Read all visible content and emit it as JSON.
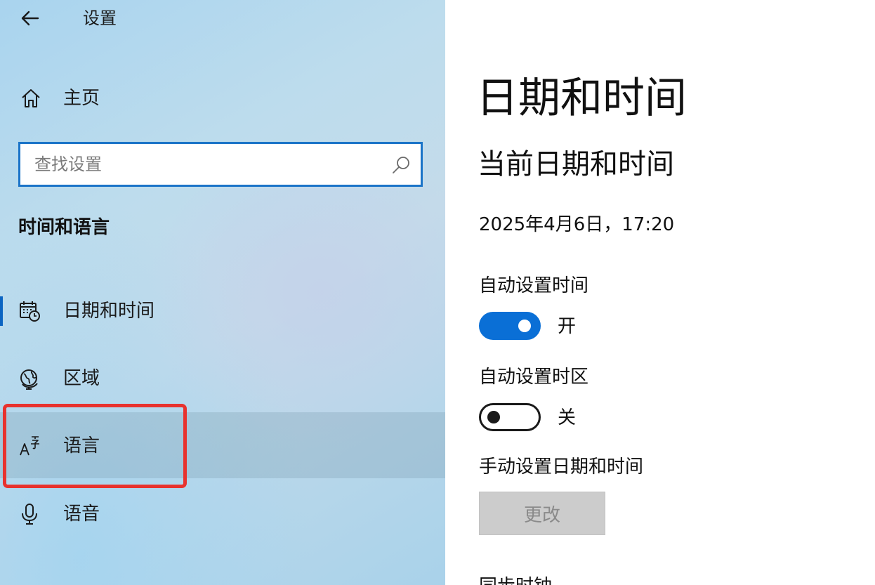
{
  "app": {
    "title": "设置"
  },
  "sidebar": {
    "home_label": "主页",
    "search": {
      "placeholder": "查找设置",
      "value": ""
    },
    "section_heading": "时间和语言",
    "items": [
      {
        "label": "日期和时间",
        "icon": "calendar-clock-icon",
        "active": true
      },
      {
        "label": "区域",
        "icon": "globe-icon",
        "active": false
      },
      {
        "label": "语言",
        "icon": "language-icon",
        "active": false,
        "highlighted": true
      },
      {
        "label": "语音",
        "icon": "microphone-icon",
        "active": false
      }
    ]
  },
  "main": {
    "page_title": "日期和时间",
    "current_section_title": "当前日期和时间",
    "current_datetime": "2025年4月6日，17:20",
    "auto_time": {
      "label": "自动设置时间",
      "on": true,
      "state_label": "开"
    },
    "auto_timezone": {
      "label": "自动设置时区",
      "on": false,
      "state_label": "关"
    },
    "manual": {
      "label": "手动设置日期和时间",
      "button_label": "更改",
      "button_enabled": false
    },
    "next_section_title": "同步时钟"
  },
  "colors": {
    "accent": "#0a6fd6",
    "search_border": "#1b74c8",
    "highlight_box": "#e8322e",
    "disabled_button": "#cccccc"
  }
}
